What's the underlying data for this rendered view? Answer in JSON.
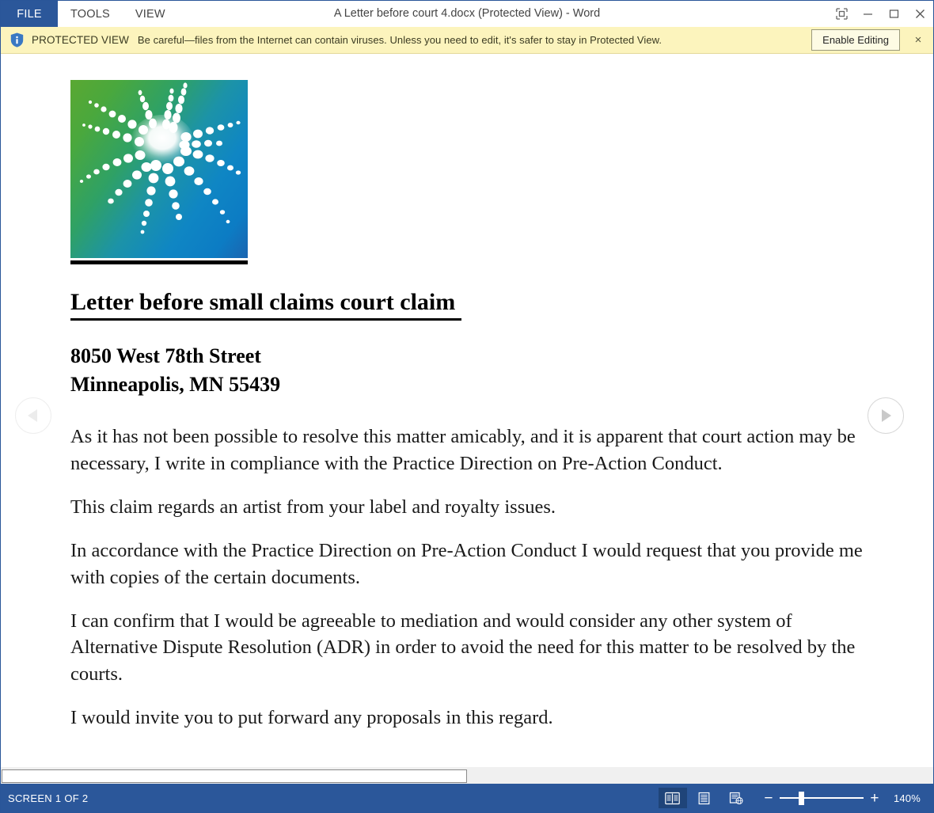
{
  "titlebar": {
    "file_tab": "FILE",
    "tabs": [
      "TOOLS",
      "VIEW"
    ],
    "document_title": "A Letter before court 4.docx (Protected View) - Word",
    "controls": [
      "ribbon-display-options",
      "minimize",
      "maximize",
      "close"
    ]
  },
  "protected_view": {
    "icon": "shield-info-icon",
    "label": "PROTECTED VIEW",
    "message": "Be careful—files from the Internet can contain viruses. Unless you need to edit, it's safer to stay in Protected View.",
    "enable_button": "Enable Editing",
    "close_label": "×",
    "background_color": "#fcf4bd"
  },
  "document": {
    "logo_alt": "green-blue-halftone-starburst-logo",
    "heading": "Letter before small claims court claim ",
    "address_line1": "8050 West 78th Street",
    "address_line2": "Minneapolis, MN 55439",
    "paragraphs": [
      "As it has not been possible to resolve this matter amicably, and it is apparent that court action may be necessary, I write in compliance with the Practice Direction on Pre-Action Conduct.",
      "This claim regards an artist from your label and royalty issues.",
      "In accordance with the Practice Direction on Pre-Action Conduct I would request that you provide me with copies of the certain documents.",
      "I can confirm that I would be agreeable to mediation and would consider any other system of Alternative Dispute Resolution (ADR) in order to avoid the need for this matter to be resolved by the courts.",
      "I would invite you to put forward any proposals in this regard."
    ]
  },
  "navigation": {
    "previous_icon": "left-triangle-icon",
    "next_icon": "right-triangle-icon"
  },
  "statusbar": {
    "screen_indicator": "SCREEN 1 OF 2",
    "view_buttons": [
      "read-mode-icon",
      "print-layout-icon",
      "web-layout-icon"
    ],
    "active_view": "read-mode-icon",
    "zoom_out": "−",
    "zoom_in": "+",
    "zoom_level": "140%",
    "background_color": "#2b579a"
  }
}
